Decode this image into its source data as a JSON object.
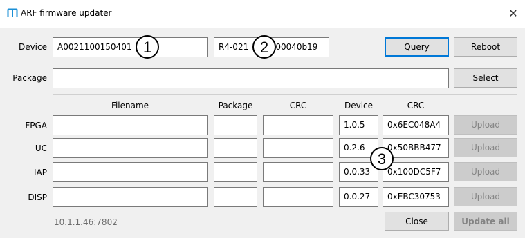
{
  "window": {
    "title": "ARF firmware updater",
    "close_glyph": "✕",
    "icon": "arf-logo-icon",
    "icon_color": "#1b8fd6"
  },
  "device": {
    "label": "Device",
    "id_value": "A0021100150401",
    "rev_value_left": "R4-021",
    "rev_value_right": "x00040b19"
  },
  "buttons": {
    "query": "Query",
    "reboot": "Reboot",
    "select": "Select",
    "close": "Close",
    "update_all": "Update all"
  },
  "package": {
    "label": "Package",
    "value": ""
  },
  "columns": {
    "filename": "Filename",
    "package": "Package",
    "crc": "CRC",
    "device": "Device",
    "device_crc": "CRC"
  },
  "rows": [
    {
      "label": "FPGA",
      "filename": "",
      "package": "",
      "crc": "",
      "device": "1.0.5",
      "device_crc": "0x6EC048A4",
      "upload": "Upload"
    },
    {
      "label": "UC",
      "filename": "",
      "package": "",
      "crc": "",
      "device": "0.2.6",
      "device_crc": "0x50BBB477",
      "upload": "Upload"
    },
    {
      "label": "IAP",
      "filename": "",
      "package": "",
      "crc": "",
      "device": "0.0.33",
      "device_crc": "0x100DC5F7",
      "upload": "Upload"
    },
    {
      "label": "DISP",
      "filename": "",
      "package": "",
      "crc": "",
      "device": "0.0.27",
      "device_crc": "0xEBC30753",
      "upload": "Upload"
    }
  ],
  "footer": {
    "address": "10.1.1.46:7802"
  },
  "markers": [
    "1",
    "2",
    "3"
  ]
}
